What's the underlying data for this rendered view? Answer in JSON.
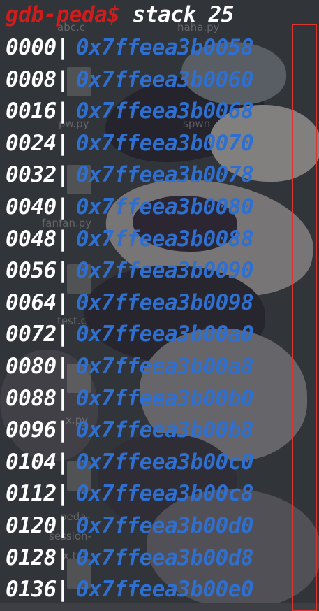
{
  "terminal": {
    "prompt": "gdb-peda$",
    "command": "stack 25"
  },
  "stack_rows": [
    {
      "offset": "0000",
      "sep": "|",
      "address": "0x7ffeea3b0058"
    },
    {
      "offset": "0008",
      "sep": "|",
      "address": "0x7ffeea3b0060"
    },
    {
      "offset": "0016",
      "sep": "|",
      "address": "0x7ffeea3b0068"
    },
    {
      "offset": "0024",
      "sep": "|",
      "address": "0x7ffeea3b0070"
    },
    {
      "offset": "0032",
      "sep": "|",
      "address": "0x7ffeea3b0078"
    },
    {
      "offset": "0040",
      "sep": "|",
      "address": "0x7ffeea3b0080"
    },
    {
      "offset": "0048",
      "sep": "|",
      "address": "0x7ffeea3b0088"
    },
    {
      "offset": "0056",
      "sep": "|",
      "address": "0x7ffeea3b0090"
    },
    {
      "offset": "0064",
      "sep": "|",
      "address": "0x7ffeea3b0098"
    },
    {
      "offset": "0072",
      "sep": "|",
      "address": "0x7ffeea3b00a0"
    },
    {
      "offset": "0080",
      "sep": "|",
      "address": "0x7ffeea3b00a8"
    },
    {
      "offset": "0088",
      "sep": "|",
      "address": "0x7ffeea3b00b0"
    },
    {
      "offset": "0096",
      "sep": "|",
      "address": "0x7ffeea3b00b8"
    },
    {
      "offset": "0104",
      "sep": "|",
      "address": "0x7ffeea3b00c0"
    },
    {
      "offset": "0112",
      "sep": "|",
      "address": "0x7ffeea3b00c8"
    },
    {
      "offset": "0120",
      "sep": "|",
      "address": "0x7ffeea3b00d0"
    },
    {
      "offset": "0128",
      "sep": "|",
      "address": "0x7ffeea3b00d8"
    },
    {
      "offset": "0136",
      "sep": "|",
      "address": "0x7ffeea3b00e0"
    }
  ],
  "desktop_labels": [
    "abc.c",
    "haha.py",
    "pw.py",
    "spwn",
    "fanfan.py",
    "test.c",
    "x.py",
    "peda-",
    "session-",
    "x.txt"
  ],
  "colors": {
    "prompt": "#d11c1c",
    "command": "#ffffff",
    "offset": "#ffffff",
    "address": "#2f6fcf",
    "highlight_box": "#e0342e"
  }
}
